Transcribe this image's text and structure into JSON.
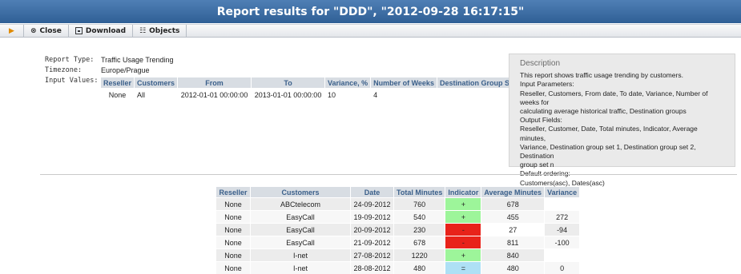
{
  "title": "Report results for \"DDD\", \"2012-09-28 16:17:15\"",
  "toolbar": {
    "close_label": "Close",
    "download_label": "Download",
    "objects_label": "Objects"
  },
  "info": {
    "report_type_label": "Report Type:",
    "report_type_value": "Traffic Usage Trending",
    "timezone_label": "Timezone:",
    "timezone_value": "Europe/Prague",
    "input_values_label": "Input Values:"
  },
  "params": {
    "headers": [
      "Reseller",
      "Customers",
      "From",
      "To",
      "Variance, %",
      "Number of Weeks",
      "Destination Group Sets"
    ],
    "row": [
      "None",
      "All",
      "2012-01-01 00:00:00",
      "2013-01-01 00:00:00",
      "10",
      "4",
      ""
    ]
  },
  "description": {
    "title": "Description",
    "lines": [
      "This report shows traffic usage trending by customers.",
      "Input Parameters:",
      "Reseller, Customers, From date, To date, Variance, Number of weeks for",
      "calculating average historical traffic, Destination groups",
      "Output Fields:",
      "Reseller, Customer, Date, Total minutes, Indicator, Average minutes,",
      "Variance, Destination group set 1, Destination group set 2, Destination",
      "group set n",
      "Default ordering:",
      "Customers(asc), Dates(asc)"
    ]
  },
  "results": {
    "headers": [
      "Reseller",
      "Customers",
      "Date",
      "Total Minutes",
      "Indicator",
      "Average Minutes",
      "Variance"
    ],
    "rows": [
      {
        "reseller": "None",
        "customer": "ABCtelecom",
        "date": "24-09-2012",
        "total": "760",
        "indicator": "+",
        "indicator_color": "green",
        "average": "678",
        "variance": ""
      },
      {
        "reseller": "None",
        "customer": "EasyCall",
        "date": "19-09-2012",
        "total": "540",
        "indicator": "+",
        "indicator_color": "green",
        "average": "455",
        "variance": "272"
      },
      {
        "reseller": "None",
        "customer": "EasyCall",
        "date": "20-09-2012",
        "total": "230",
        "indicator": "-",
        "indicator_color": "red",
        "average": "27",
        "variance": "-94"
      },
      {
        "reseller": "None",
        "customer": "EasyCall",
        "date": "21-09-2012",
        "total": "678",
        "indicator": "-",
        "indicator_color": "red",
        "average": "811",
        "variance": "-100"
      },
      {
        "reseller": "None",
        "customer": "I-net",
        "date": "27-08-2012",
        "total": "1220",
        "indicator": "+",
        "indicator_color": "green",
        "average": "840",
        "variance": ""
      },
      {
        "reseller": "None",
        "customer": "I-net",
        "date": "28-08-2012",
        "total": "480",
        "indicator": "=",
        "indicator_color": "blue",
        "average": "480",
        "variance": "0"
      }
    ]
  },
  "colors": {
    "title_bar": "#3a6aa3",
    "indicator_green": "#9df59a",
    "indicator_red": "#e8231a",
    "indicator_blue": "#aee0f5",
    "header_text": "#3a5f8a"
  }
}
